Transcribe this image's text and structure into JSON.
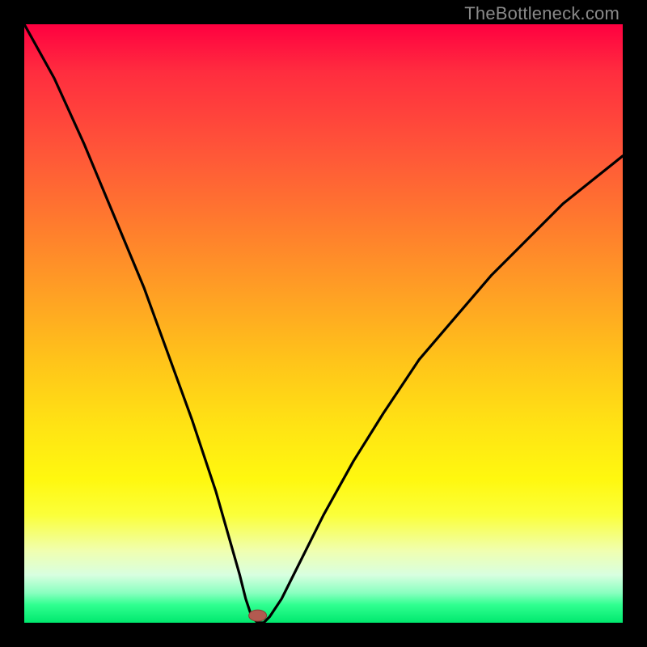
{
  "watermark": "TheBottleneck.com",
  "chart_data": {
    "type": "line",
    "title": "",
    "xlabel": "",
    "ylabel": "",
    "xlim": [
      0,
      100
    ],
    "ylim": [
      0,
      100
    ],
    "grid": false,
    "legend": false,
    "series": [
      {
        "name": "bottleneck-curve",
        "x": [
          0,
          5,
          10,
          15,
          20,
          24,
          28,
          32,
          34,
          36,
          37,
          38,
          39,
          40,
          41,
          43,
          46,
          50,
          55,
          60,
          66,
          72,
          78,
          84,
          90,
          95,
          100
        ],
        "values": [
          100,
          91,
          80,
          68,
          56,
          45,
          34,
          22,
          15,
          8,
          4,
          1,
          0,
          0,
          1,
          4,
          10,
          18,
          27,
          35,
          44,
          51,
          58,
          64,
          70,
          74,
          78
        ]
      }
    ],
    "marker": {
      "name": "optimal-point",
      "x": 39,
      "y": 1.2,
      "color": "#b35a50"
    },
    "background_gradient_stops": [
      {
        "pos": 0,
        "color": "#ff0040"
      },
      {
        "pos": 33,
        "color": "#ff7a2e"
      },
      {
        "pos": 67,
        "color": "#ffe314"
      },
      {
        "pos": 88,
        "color": "#f0ffb0"
      },
      {
        "pos": 100,
        "color": "#00e86e"
      }
    ]
  }
}
